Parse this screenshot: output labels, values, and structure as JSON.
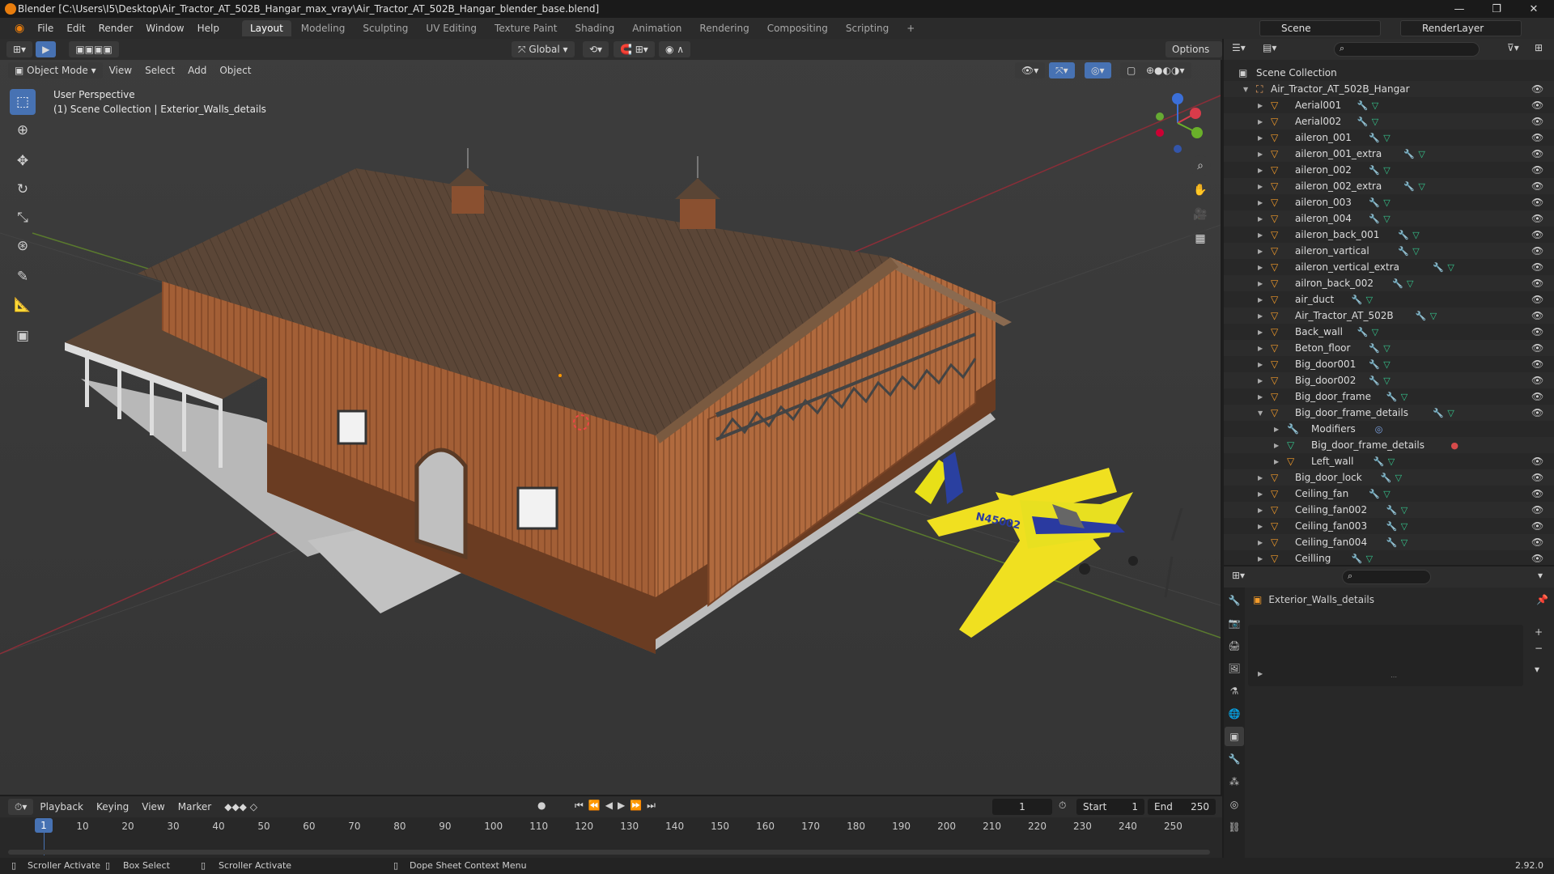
{
  "window": {
    "title": "Blender [C:\\Users\\I5\\Desktop\\Air_Tractor_AT_502B_Hangar_max_vray\\Air_Tractor_AT_502B_Hangar_blender_base.blend]",
    "minimize": "—",
    "maximize": "❐",
    "close": "✕"
  },
  "menu": [
    "File",
    "Edit",
    "Render",
    "Window",
    "Help"
  ],
  "workspaces": [
    "Layout",
    "Modeling",
    "Sculpting",
    "UV Editing",
    "Texture Paint",
    "Shading",
    "Animation",
    "Rendering",
    "Compositing",
    "Scripting",
    "+"
  ],
  "scene": {
    "name": "Scene",
    "render_layer": "RenderLayer"
  },
  "viewport": {
    "mode": "Object Mode",
    "menus": [
      "View",
      "Select",
      "Add",
      "Object"
    ],
    "transform": "Global",
    "options": "Options",
    "perspective": "User Perspective",
    "collection_info": "(1) Scene Collection | Exterior_Walls_details"
  },
  "outliner": {
    "root": "Scene Collection",
    "collection": "Air_Tractor_AT_502B_Hangar",
    "items": [
      {
        "name": "Aerial001",
        "level": 0
      },
      {
        "name": "Aerial002",
        "level": 0
      },
      {
        "name": "aileron_001",
        "level": 0
      },
      {
        "name": "aileron_001_extra",
        "level": 0
      },
      {
        "name": "aileron_002",
        "level": 0
      },
      {
        "name": "aileron_002_extra",
        "level": 0
      },
      {
        "name": "aileron_003",
        "level": 0
      },
      {
        "name": "aileron_004",
        "level": 0
      },
      {
        "name": "aileron_back_001",
        "level": 0
      },
      {
        "name": "aileron_vartical",
        "level": 0
      },
      {
        "name": "aileron_vertical_extra",
        "level": 0
      },
      {
        "name": "ailron_back_002",
        "level": 0
      },
      {
        "name": "air_duct",
        "level": 0
      },
      {
        "name": "Air_Tractor_AT_502B",
        "level": 0
      },
      {
        "name": "Back_wall",
        "level": 0
      },
      {
        "name": "Beton_floor",
        "level": 0
      },
      {
        "name": "Big_door001",
        "level": 0
      },
      {
        "name": "Big_door002",
        "level": 0
      },
      {
        "name": "Big_door_frame",
        "level": 0
      },
      {
        "name": "Big_door_frame_details",
        "level": 0,
        "expanded": true
      },
      {
        "name": "Modifiers",
        "level": 1
      },
      {
        "name": "Big_door_frame_details",
        "level": 1
      },
      {
        "name": "Left_wall",
        "level": 1
      },
      {
        "name": "Big_door_lock",
        "level": 0
      },
      {
        "name": "Ceiling_fan",
        "level": 0
      },
      {
        "name": "Ceiling_fan002",
        "level": 0
      },
      {
        "name": "Ceiling_fan003",
        "level": 0
      },
      {
        "name": "Ceiling_fan004",
        "level": 0
      },
      {
        "name": "Ceilling",
        "level": 0
      }
    ]
  },
  "properties": {
    "object_name": "Exterior_Walls_details"
  },
  "timeline": {
    "menus": [
      "Playback",
      "Keying",
      "View",
      "Marker"
    ],
    "current_frame": "1",
    "start_label": "Start",
    "start": "1",
    "end_label": "End",
    "end": "250",
    "ticks": [
      "10",
      "20",
      "30",
      "40",
      "50",
      "60",
      "70",
      "80",
      "90",
      "100",
      "110",
      "120",
      "130",
      "140",
      "150",
      "160",
      "170",
      "180",
      "190",
      "200",
      "210",
      "220",
      "230",
      "240",
      "250"
    ]
  },
  "status": {
    "item1": "Scroller Activate",
    "item2": "Box Select",
    "item3": "Scroller Activate",
    "item4": "Dope Sheet Context Menu",
    "version": "2.92.0"
  },
  "aircraft_marking": "N45002",
  "colors": {
    "accent": "#4772b3",
    "object_orange": "#f39b2a",
    "mesh_green": "#35c48c",
    "wall_wood": "#a0603a",
    "roof": "#5e4a3c",
    "plane_yellow": "#f0e020"
  }
}
